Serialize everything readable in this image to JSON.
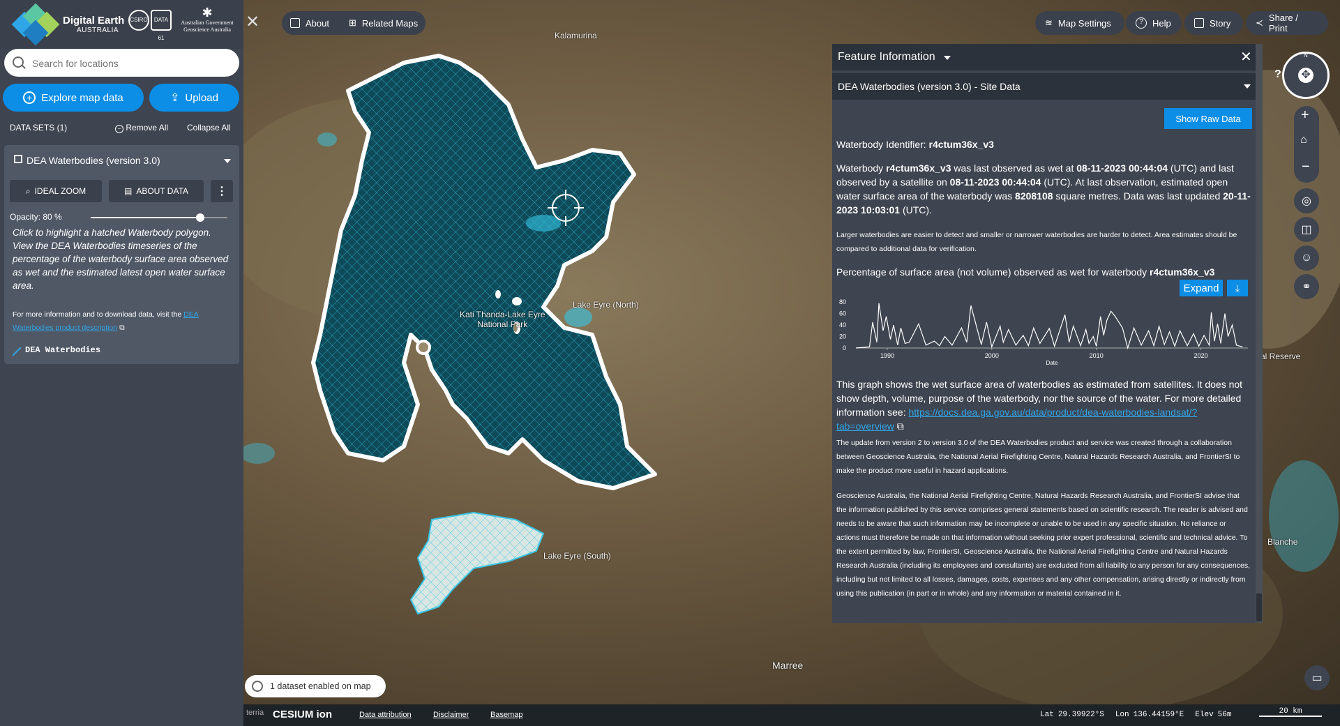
{
  "brand": {
    "title": "Digital Earth",
    "subtitle": "AUSTRALIA",
    "partner1": "CSIRO",
    "partner2": "DATA 61",
    "gov_line1": "Australian Government",
    "gov_line2": "Geoscience Australia"
  },
  "search": {
    "placeholder": "Search for locations"
  },
  "actions": {
    "explore": "Explore map data",
    "upload": "Upload"
  },
  "datasets": {
    "header": "DATA SETS (1)",
    "remove_all": "Remove All",
    "collapse_all": "Collapse All"
  },
  "dataset": {
    "title": "DEA Waterbodies (version 3.0)",
    "ideal_zoom": "IDEAL ZOOM",
    "about_data": "ABOUT DATA",
    "opacity_label": "Opacity: 80 %",
    "opacity": 0.8,
    "description": "Click to highlight a hatched Waterbody polygon. View the DEA Waterbodies timeseries of the percentage of the waterbody surface area observed as wet and the estimated latest open water surface area.",
    "info_prefix": "For more information and to download data, visit the ",
    "info_link": "DEA Waterbodies product description",
    "legend_name": "DEA Waterbodies"
  },
  "toolbar": {
    "about": "About",
    "related_maps": "Related Maps",
    "map_settings": "Map Settings",
    "help": "Help",
    "story": "Story",
    "share": "Share / Print"
  },
  "feature": {
    "title": "Feature Information",
    "selector": "DEA Waterbodies (version 3.0) - Site Data",
    "show_raw": "Show Raw Data",
    "identifier_label": "Waterbody Identifier: ",
    "identifier": "r4ctum36x_v3",
    "obs_1": "Waterbody ",
    "obs_2": " was last observed as wet at ",
    "wet_time": "08-11-2023 00:44:04",
    "obs_3": " (UTC) and last observed by a satellite on ",
    "sat_time": "08-11-2023 00:44:04",
    "obs_4": " (UTC). At last observation, estimated open water surface area of the waterbody was ",
    "area": "8208108",
    "obs_5": " square metres. Data was last updated ",
    "updated": "20-11-2023 10:03:01",
    "obs_6": " (UTC).",
    "note": "Larger waterbodies are easier to detect and smaller or narrower waterbodies are harder to detect. Area estimates should be compared to additional data for verification.",
    "chart_heading": "Percentage of surface area (not volume) observed as wet for waterbody ",
    "expand": "Expand",
    "graph_desc": "This graph shows the wet surface area of waterbodies as estimated from satellites. It does not show depth, volume, purpose of the waterbody, nor the source of the water. For more detailed information see: ",
    "graph_link": "https://docs.dea.ga.gov.au/data/product/dea-waterbodies-landsat/?tab=overview",
    "update_note": "The update from version 2 to version 3.0 of the DEA Waterbodies product and service was created through a collaboration between Geoscience Australia, the National Aerial Firefighting Centre, Natural Hazards Research Australia, and FrontierSI to make the product more useful in hazard applications.",
    "disclaimer": "Geoscience Australia, the National Aerial Firefighting Centre, Natural Hazards Research Australia, and FrontierSI advise that the information published by this service comprises general statements based on scientific research. The reader is advised and needs to be aware that such information may be incomplete or unable to be used in any specific situation. No reliance or actions must therefore be made on that information without seeking prior expert professional, scientific and technical advice. To the extent permitted by law, FrontierSI, Geoscience Australia, the National Aerial Firefighting Centre and Natural Hazards Research Australia (including its employees and consultants) are excluded from all liability to any person for any consequences, including but not limited to all losses, damages, costs, expenses and any other compensation, arising directly or indirectly from using this publication (in part or in whole) and any information or material contained in it."
  },
  "chart_data": {
    "type": "line",
    "title": "",
    "xlabel": "Date",
    "ylabel": "",
    "x_ticks": [
      "1990",
      "2000",
      "2010",
      "2020"
    ],
    "y_ticks": [
      "0",
      "20",
      "40",
      "60",
      "80"
    ],
    "xlim": [
      1987,
      2024.5
    ],
    "ylim": [
      0,
      85
    ],
    "series": [
      {
        "x": [
          1987,
          1988.3,
          1988.6,
          1989.0,
          1989.2,
          1989.6,
          1989.9,
          1990.3,
          1990.6,
          1991.0,
          1991.3,
          1991.7,
          1992.1,
          1993.0,
          1993.7,
          1994.5,
          1995.0,
          1995.5,
          1996.2,
          1997.1,
          1997.6,
          1998.0,
          1999.0,
          1999.5,
          2000.0,
          2000.8,
          2001.1,
          2001.6,
          2002.3,
          2003.0,
          2003.5,
          2004.0,
          2004.6,
          2005.5,
          2006.0,
          2007.0,
          2007.4,
          2007.8,
          2008.5,
          2009.0,
          2009.3,
          2009.7,
          2010.0,
          2010.4,
          2010.7,
          2011.0,
          2011.4,
          2011.8,
          2012.5,
          2013.0,
          2013.6,
          2014.3,
          2015.0,
          2015.5,
          2016.0,
          2016.5,
          2017.0,
          2017.5,
          2018.0,
          2018.7,
          2019.3,
          2019.8,
          2020.3,
          2020.8,
          2021.0,
          2021.3,
          2021.6,
          2021.9,
          2022.3,
          2022.6,
          2023.0,
          2023.4,
          2024.0
        ],
        "y": [
          0,
          2,
          45,
          10,
          78,
          30,
          55,
          15,
          40,
          5,
          35,
          8,
          10,
          42,
          5,
          12,
          4,
          20,
          5,
          35,
          10,
          74,
          6,
          45,
          2,
          38,
          10,
          32,
          5,
          22,
          4,
          35,
          8,
          34,
          3,
          58,
          10,
          38,
          4,
          32,
          8,
          20,
          3,
          55,
          22,
          48,
          64,
          55,
          35,
          0,
          35,
          5,
          30,
          4,
          38,
          6,
          28,
          3,
          30,
          4,
          25,
          3,
          22,
          5,
          62,
          12,
          42,
          8,
          60,
          20,
          40,
          5,
          2
        ]
      }
    ]
  },
  "map_labels": {
    "kalamurina": "Kalamurina",
    "park_1": "Kati Thanda-Lake Eyre",
    "park_2": "National Park",
    "north": "Lake Eyre (North)",
    "south": "Lake Eyre (South)",
    "marree": "Marree",
    "reserve": "al Reserve",
    "blanche": "Blanche"
  },
  "status": {
    "datasets_enabled": "1 dataset enabled on map"
  },
  "bottom": {
    "cesium": "CESIUM ion",
    "attribution": "Data attribution",
    "disclaimer": "Disclaimer",
    "basemap": "Basemap",
    "lat_label": "Lat",
    "lat": "29.39922°S",
    "lon_label": "Lon",
    "lon": "136.44159°E",
    "elev_label": "Elev",
    "elev": "56m",
    "scale": "20 km"
  },
  "compass": {
    "north": "N"
  },
  "colors": {
    "accent": "#0c8ee6",
    "panel": "#3e4450",
    "water": "#0e4a58",
    "hatch": "#36c6e6"
  }
}
